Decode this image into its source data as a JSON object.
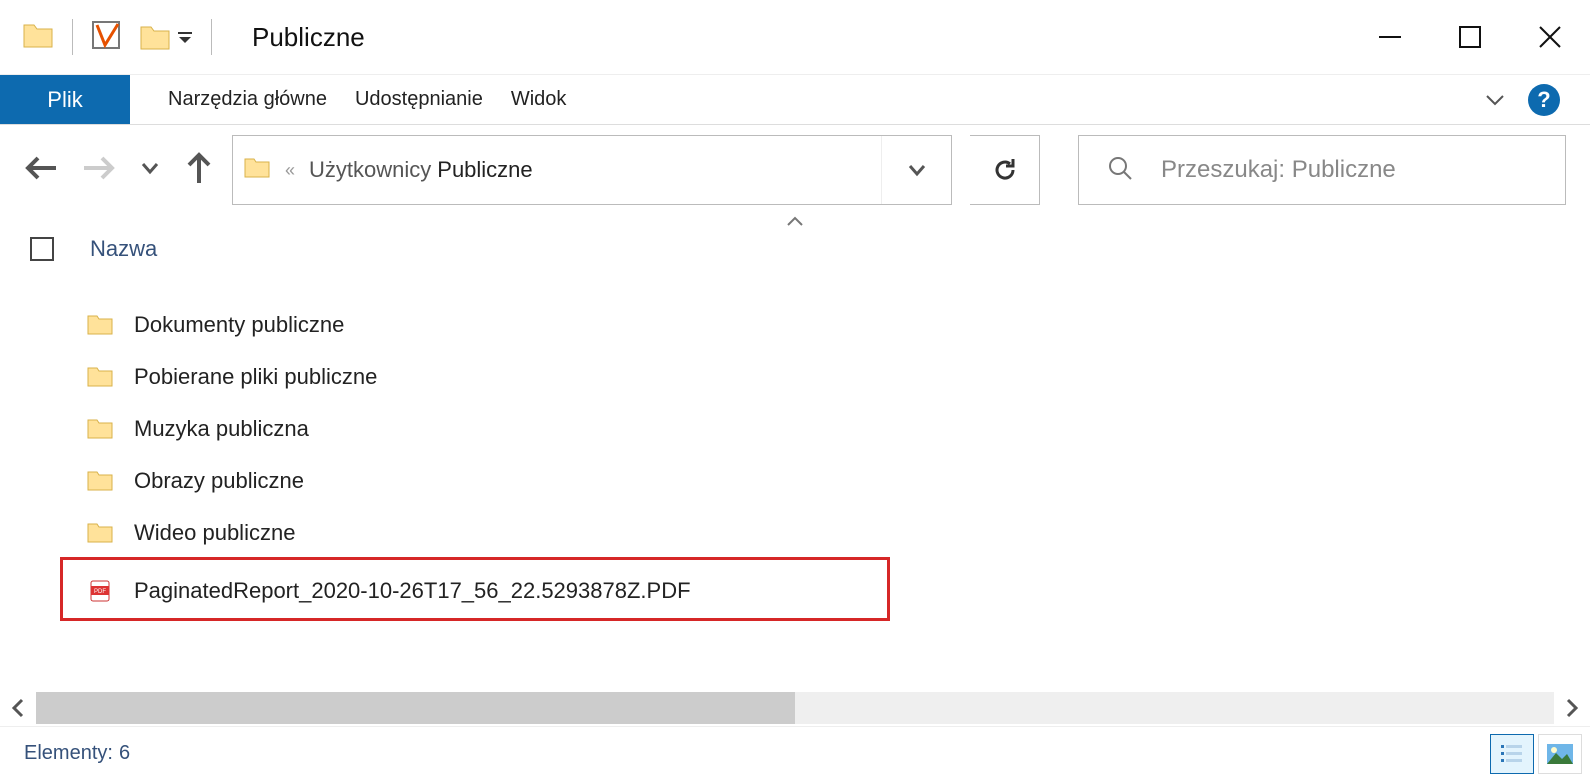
{
  "window": {
    "title": "Publiczne"
  },
  "ribbon": {
    "file_label": "Plik",
    "tabs": [
      "Narzędzia główne",
      "Udostępnianie",
      "Widok"
    ],
    "help_char": "?"
  },
  "breadcrumb": {
    "parent": "Użytkownicy",
    "current": "Publiczne"
  },
  "search": {
    "placeholder": "Przeszukaj: Publiczne"
  },
  "columns": {
    "name_header": "Nazwa"
  },
  "items": [
    {
      "type": "folder",
      "name": "Dokumenty publiczne"
    },
    {
      "type": "folder",
      "name": "Pobierane pliki publiczne"
    },
    {
      "type": "folder",
      "name": "Muzyka publiczna"
    },
    {
      "type": "folder",
      "name": "Obrazy publiczne"
    },
    {
      "type": "folder",
      "name": "Wideo publiczne"
    },
    {
      "type": "pdf",
      "name": "PaginatedReport_2020-10-26T17_56_22.5293878Z.PDF"
    }
  ],
  "status": {
    "items_label": "Elementy:",
    "count": "6"
  }
}
